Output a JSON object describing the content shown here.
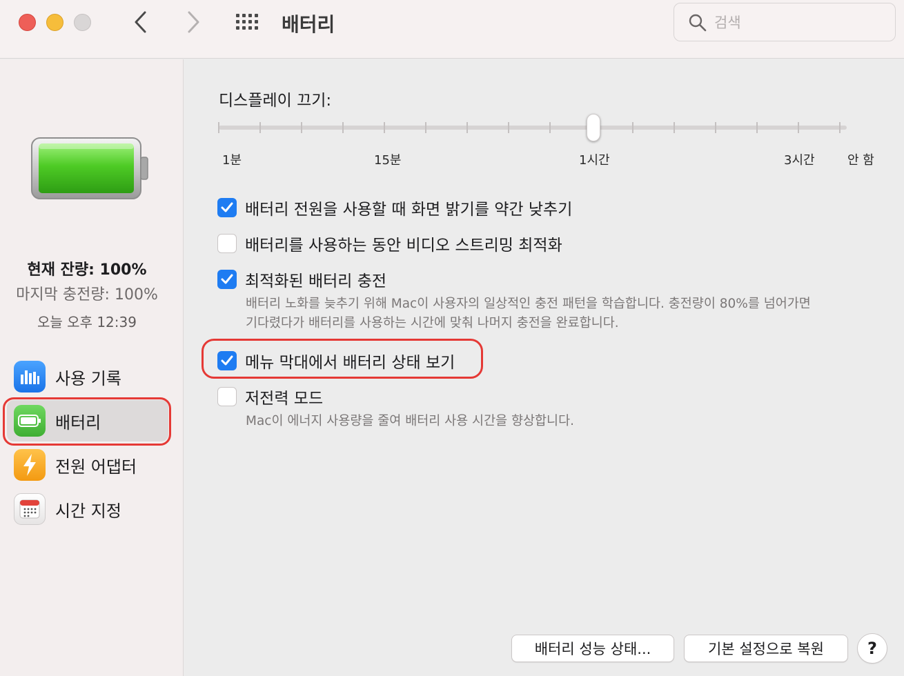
{
  "window": {
    "title": "배터리",
    "search_placeholder": "검색"
  },
  "sidebar": {
    "status": {
      "current_charge": "현재 잔량: 100%",
      "last_charge": "마지막 충전량: 100%",
      "time": "오늘 오후 12:39"
    },
    "battery_level": 1.0,
    "items": [
      {
        "label": "사용 기록",
        "icon": "bar-chart-icon"
      },
      {
        "label": "배터리",
        "icon": "battery-icon",
        "selected": true
      },
      {
        "label": "전원 어댑터",
        "icon": "lightning-icon"
      },
      {
        "label": "시간 지정",
        "icon": "calendar-icon"
      }
    ]
  },
  "display_sleep": {
    "title": "디스플레이 끄기:",
    "labels": [
      "1분",
      "15분",
      "1시간",
      "3시간",
      "안 함"
    ],
    "value": "1시간"
  },
  "options": [
    {
      "label": "배터리 전원을 사용할 때 화면 밝기를 약간 낮추기",
      "checked": true
    },
    {
      "label": "배터리를 사용하는 동안 비디오 스트리밍 최적화",
      "checked": false
    },
    {
      "label": "최적화된 배터리 충전",
      "checked": true,
      "description_line1": "배터리 노화를 늦추기 위해 Mac이 사용자의 일상적인 충전 패턴을 학습합니다. 충전량이 80%를 넘어가면",
      "description_line2": "기다렸다가 배터리를 사용하는 시간에 맞춰 나머지 충전을 완료합니다."
    },
    {
      "label": "메뉴 막대에서 배터리 상태 보기",
      "checked": true
    },
    {
      "label": "저전력 모드",
      "checked": false,
      "description_line1": "Mac이 에너지 사용량을 줄여 배터리 사용 시간을 향상합니다."
    }
  ],
  "buttons": {
    "battery_health": "배터리 성능 상태...",
    "restore_defaults": "기본 설정으로 복원",
    "help": "?"
  },
  "colors": {
    "accent": "#1e7cf2",
    "highlight": "#e53935",
    "battery_green": "#5fd43b"
  }
}
